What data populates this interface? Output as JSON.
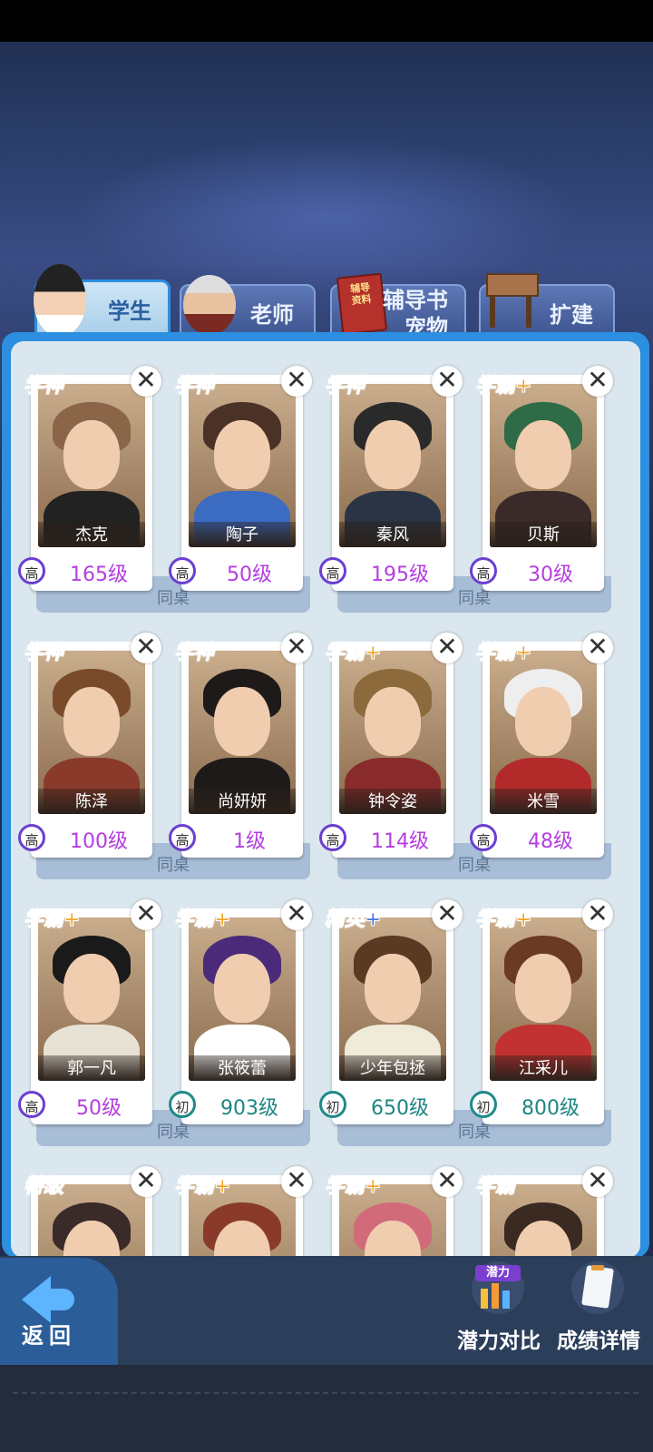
{
  "tabs": [
    {
      "label": "学生",
      "active": true
    },
    {
      "label": "老师",
      "active": false
    },
    {
      "label": "辅导书\n宠物",
      "line1": "辅导书",
      "line2": "宠物",
      "book_text": "辅导\n资料",
      "active": false
    },
    {
      "label": "扩建",
      "active": false
    }
  ],
  "desk_label": "同桌",
  "students": [
    {
      "name": "杰克",
      "rank": "学神",
      "grade": "高",
      "level": "165级"
    },
    {
      "name": "陶子",
      "rank": "学神",
      "grade": "高",
      "level": "50级"
    },
    {
      "name": "秦风",
      "rank": "学神",
      "grade": "高",
      "level": "195级"
    },
    {
      "name": "贝斯",
      "rank": "学霸+",
      "grade": "高",
      "level": "30级"
    },
    {
      "name": "陈泽",
      "rank": "学神",
      "grade": "高",
      "level": "100级"
    },
    {
      "name": "尚妍妍",
      "rank": "学神",
      "grade": "高",
      "level": "1级"
    },
    {
      "name": "钟令姿",
      "rank": "学霸+",
      "grade": "高",
      "level": "114级"
    },
    {
      "name": "米雪",
      "rank": "学霸+",
      "grade": "高",
      "level": "48级"
    },
    {
      "name": "郭一凡",
      "rank": "学霸+",
      "grade": "高",
      "level": "50级"
    },
    {
      "name": "张筱蕾",
      "rank": "学霸+",
      "grade": "初",
      "level": "903级"
    },
    {
      "name": "少年包拯",
      "rank": "精英+",
      "grade": "初",
      "level": "650级"
    },
    {
      "name": "江采儿",
      "rank": "学霸+",
      "grade": "初",
      "level": "800级"
    },
    {
      "rank": "特级"
    },
    {
      "rank": "学霸+"
    },
    {
      "rank": "学霸+"
    },
    {
      "rank": "学霸"
    }
  ],
  "bottom": {
    "back_label": "返回",
    "potential_label": "潜力对比",
    "potential_icon_text": "潜力",
    "grades_label": "成绩详情"
  },
  "colors": {
    "panel_border": "#2c8fe0",
    "level_high": "#b53de0",
    "level_junior": "#1d8683",
    "rank_god": "#e8304d",
    "rank_ba": "#f2a21a"
  }
}
